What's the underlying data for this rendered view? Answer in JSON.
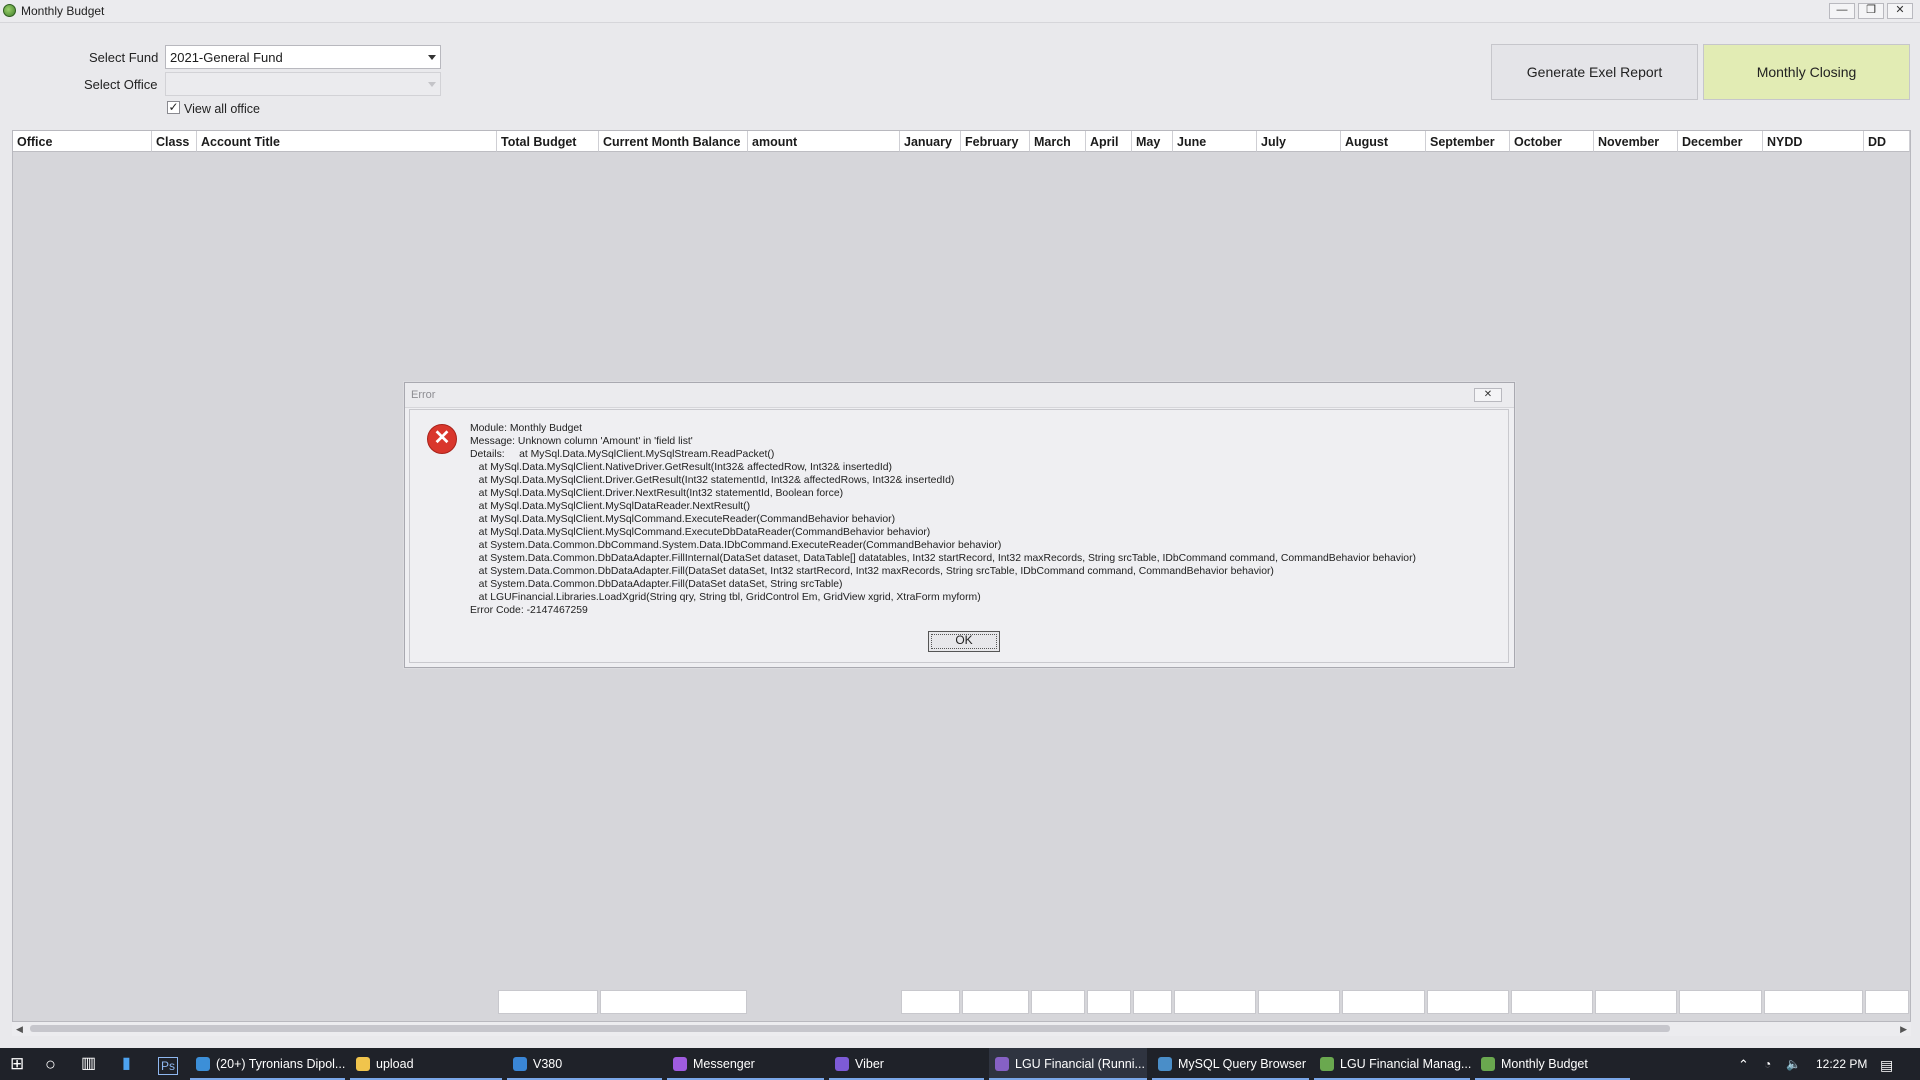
{
  "window": {
    "title": "Monthly Budget"
  },
  "window_controls": {
    "minimize": "—",
    "maximize": "❐",
    "close": "✕"
  },
  "filters": {
    "fund_label": "Select Fund",
    "fund_value": "2021-General Fund",
    "office_label": "Select Office",
    "office_value": "",
    "view_all_label": "View all office",
    "view_all_checked": "✓"
  },
  "actions": {
    "generate_report": "Generate Exel Report",
    "monthly_closing": "Monthly Closing",
    "monthly_closing_color": "#e2ecb4"
  },
  "grid": {
    "columns": [
      "Office",
      "Class",
      "Account Title",
      "Total Budget",
      "Current Month Balance",
      "amount",
      "January",
      "February",
      "March",
      "April",
      "May",
      "June",
      "July",
      "August",
      "September",
      "October",
      "November",
      "December",
      "NYDD",
      "DD"
    ]
  },
  "error_dialog": {
    "title": "Error",
    "close_glyph": "✕",
    "icon_glyph": "✕",
    "lines": [
      "Module: Monthly Budget",
      "Message: Unknown column 'Amount' in 'field list'",
      "Details:     at MySql.Data.MySqlClient.MySqlStream.ReadPacket()",
      "   at MySql.Data.MySqlClient.NativeDriver.GetResult(Int32& affectedRow, Int32& insertedId)",
      "   at MySql.Data.MySqlClient.Driver.GetResult(Int32 statementId, Int32& affectedRows, Int32& insertedId)",
      "   at MySql.Data.MySqlClient.Driver.NextResult(Int32 statementId, Boolean force)",
      "   at MySql.Data.MySqlClient.MySqlDataReader.NextResult()",
      "   at MySql.Data.MySqlClient.MySqlCommand.ExecuteReader(CommandBehavior behavior)",
      "   at MySql.Data.MySqlClient.MySqlCommand.ExecuteDbDataReader(CommandBehavior behavior)",
      "   at System.Data.Common.DbCommand.System.Data.IDbCommand.ExecuteReader(CommandBehavior behavior)",
      "   at System.Data.Common.DbDataAdapter.FillInternal(DataSet dataset, DataTable[] datatables, Int32 startRecord, Int32 maxRecords, String srcTable, IDbCommand command, CommandBehavior behavior)",
      "   at System.Data.Common.DbDataAdapter.Fill(DataSet dataSet, Int32 startRecord, Int32 maxRecords, String srcTable, IDbCommand command, CommandBehavior behavior)",
      "   at System.Data.Common.DbDataAdapter.Fill(DataSet dataSet, String srcTable)",
      "   at LGUFinancial.Libraries.LoadXgrid(String qry, String tbl, GridControl Em, GridView xgrid, XtraForm myform)",
      "Error Code: -2147467259"
    ],
    "ok_label": "OK",
    "error_color": "#d9362c"
  },
  "taskbar": {
    "start_icon": "windows-logo-icon",
    "items": [
      {
        "label": "(20+) Tyronians Dipol...",
        "icon": "edge-browser-icon",
        "color": "#3c8fd8"
      },
      {
        "label": "upload",
        "icon": "folder-icon",
        "color": "#f0c44c"
      },
      {
        "label": "V380",
        "icon": "v380-app-icon",
        "color": "#3a86d6"
      },
      {
        "label": "Messenger",
        "icon": "messenger-icon",
        "color": "#a05ce0"
      },
      {
        "label": "Viber",
        "icon": "viber-icon",
        "color": "#7d5bd6"
      },
      {
        "label": "LGU Financial (Runni...",
        "icon": "visual-studio-icon",
        "color": "#8661c5"
      },
      {
        "label": "MySQL Query Browser",
        "icon": "mysql-icon",
        "color": "#4a8ec8"
      },
      {
        "label": "LGU Financial Manag...",
        "icon": "lgu-app-icon",
        "color": "#6aa84f"
      },
      {
        "label": "Monthly Budget",
        "icon": "lgu-app-icon",
        "color": "#6aa84f"
      }
    ],
    "clock": "12:22 PM"
  }
}
